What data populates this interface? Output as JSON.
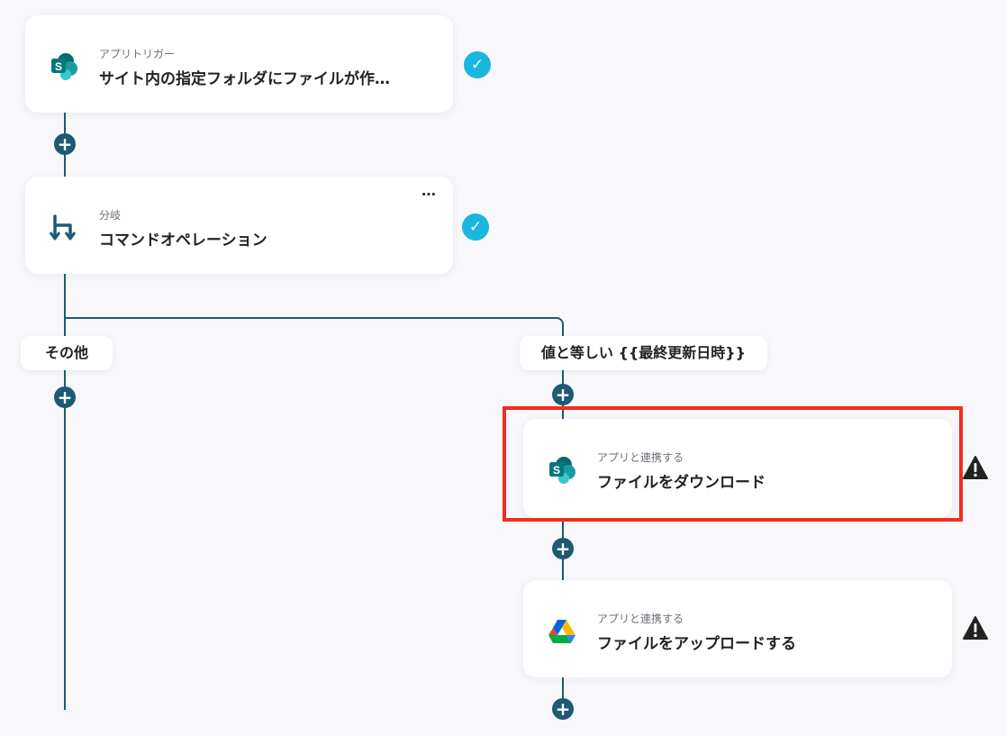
{
  "steps": [
    {
      "category": "アプリトリガー",
      "title": "サイト内の指定フォルダにファイルが作成されたら",
      "icon": "sharepoint-icon",
      "status": "complete"
    },
    {
      "category": "分岐",
      "title": "コマンドオペレーション",
      "icon": "branch-icon",
      "status": "complete",
      "menu_label": "⋯"
    }
  ],
  "branches": {
    "left_label": "その他",
    "right_label": "値と等しい {{最終更新日時}}"
  },
  "right_steps": [
    {
      "category": "アプリと連携する",
      "title": "ファイルをダウンロード",
      "icon": "sharepoint-icon",
      "status": "warning"
    },
    {
      "category": "アプリと連携する",
      "title": "ファイルをアップロードする",
      "icon": "google-drive-icon",
      "status": "warning"
    }
  ],
  "colors": {
    "connector": "#1d5a74",
    "check": "#1ab6de",
    "highlight": "#f22d1e",
    "warning": "#222222"
  },
  "add_label": "+",
  "check_label": "✓"
}
